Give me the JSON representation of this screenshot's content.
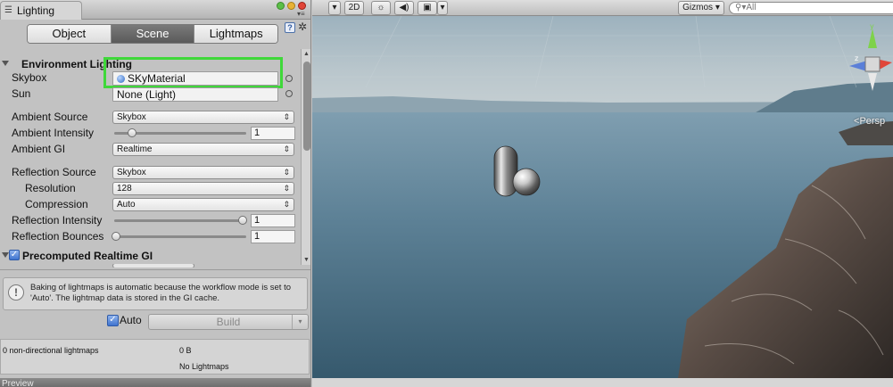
{
  "window": {
    "tab_title": "Lighting",
    "tab_icon": "lighting-list-icon"
  },
  "mode_tabs": [
    {
      "label": "Object",
      "active": false
    },
    {
      "label": "Scene",
      "active": true
    },
    {
      "label": "Lightmaps",
      "active": false
    }
  ],
  "environment": {
    "header": "Environment Lighting",
    "skybox_label": "Skybox",
    "skybox_value": "SKyMaterial",
    "sun_label": "Sun",
    "sun_value": "None (Light)",
    "ambient_source_label": "Ambient Source",
    "ambient_source_value": "Skybox",
    "ambient_intensity_label": "Ambient Intensity",
    "ambient_intensity_value": "1",
    "ambient_gi_label": "Ambient GI",
    "ambient_gi_value": "Realtime",
    "reflection_source_label": "Reflection Source",
    "reflection_source_value": "Skybox",
    "resolution_label": "Resolution",
    "resolution_value": "128",
    "compression_label": "Compression",
    "compression_value": "Auto",
    "reflection_intensity_label": "Reflection Intensity",
    "reflection_intensity_value": "1",
    "reflection_bounces_label": "Reflection Bounces",
    "reflection_bounces_value": "1"
  },
  "precomputed": {
    "header": "Precomputed Realtime GI",
    "enabled": true
  },
  "info": {
    "text": "Baking of lightmaps is automatic because the workflow mode is set to 'Auto'. The lightmap data is stored in the GI cache."
  },
  "build": {
    "auto_label": "Auto",
    "auto_checked": true,
    "build_label": "Build"
  },
  "stats": {
    "lightmaps_label": "0 non-directional lightmaps",
    "size_value": "0 B",
    "no_lightmaps": "No Lightmaps"
  },
  "preview": {
    "label": "Preview"
  },
  "scene_toolbar": {
    "mode_2d": "2D",
    "gizmos_label": "Gizmos",
    "search_placeholder": "All",
    "persp_label": "Persp"
  },
  "colors": {
    "highlight": "#3fd83a",
    "active_tab": "#626262",
    "checkbox": "#3f74cf"
  }
}
